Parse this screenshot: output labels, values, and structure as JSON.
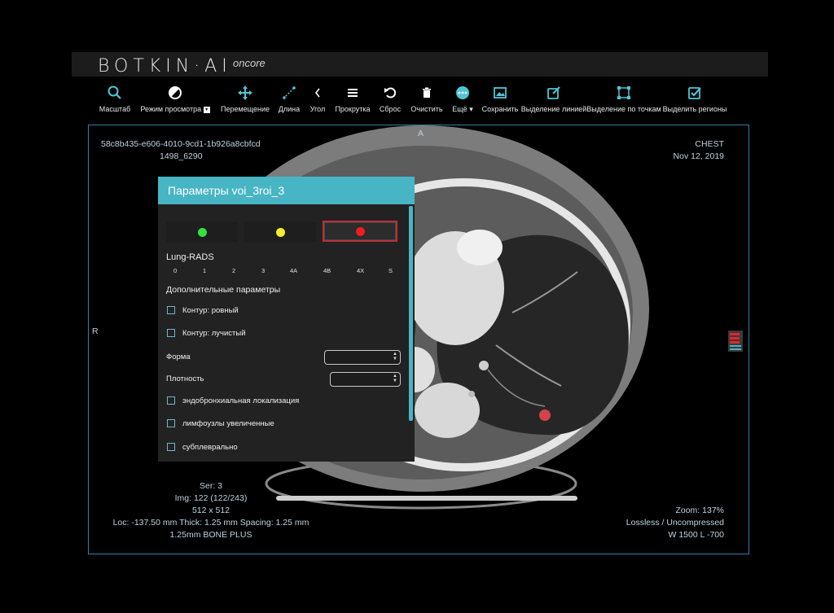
{
  "app": {
    "logo": "BOTKIN·AI",
    "logo_sub": "oncore"
  },
  "toolbar": [
    {
      "label": "Масштаб",
      "icon": "search-icon"
    },
    {
      "label": "Режим просмотра",
      "icon": "contrast-icon"
    },
    {
      "label": "Перемещение",
      "icon": "move-icon"
    },
    {
      "label": "Длина",
      "icon": "ruler-icon"
    },
    {
      "label": "Угол",
      "icon": "angle-icon"
    },
    {
      "label": "Прокрутка",
      "icon": "menu-icon"
    },
    {
      "label": "Сброс",
      "icon": "undo-icon"
    },
    {
      "label": "Очистить",
      "icon": "trash-icon"
    },
    {
      "label": "Ещё",
      "icon": "more-icon"
    },
    {
      "label": "Сохранить",
      "icon": "image-icon"
    },
    {
      "label": "Выделение линией",
      "icon": "edit-icon"
    },
    {
      "label": "Выделение по точкам",
      "icon": "points-select-icon"
    },
    {
      "label": "Выделить регионы",
      "icon": "check-square-icon"
    }
  ],
  "viewer": {
    "top_left": [
      "58c8b435-e606-4010-9cd1-1b926a8cbfcd",
      "1498_6290"
    ],
    "top_right": [
      "CHEST",
      "Nov 12, 2019"
    ],
    "orient_top": "A",
    "orient_left": "R",
    "bottom_left": [
      "Ser: 3",
      "Img: 122 (122/243)",
      "512 x 512",
      "Loc: -137.50 mm Thick: 1.25 mm Spacing: 1.25 mm",
      "1.25mm BONE PLUS"
    ],
    "bottom_right": [
      "Zoom: 137%",
      "Lossless / Uncompressed",
      "W 1500 L -700"
    ]
  },
  "panel": {
    "title": "Параметры voi_3roi_3",
    "colors": [
      {
        "name": "green",
        "hex": "#33e23e"
      },
      {
        "name": "yellow",
        "hex": "#f2ee2e"
      },
      {
        "name": "red",
        "hex": "#ee1d24",
        "selected": true
      }
    ],
    "lung_rads_label": "Lung-RADS",
    "lung_rads_options": [
      "0",
      "1",
      "2",
      "3",
      "4A",
      "4B",
      "4X",
      "S"
    ],
    "extra_label": "Дополнительные параметры",
    "check_contour_smooth": "Контур: ровный",
    "check_contour_spiculated": "Контур: лучистый",
    "shape_label": "Форма",
    "density_label": "Плотность",
    "check_endobronchial": "эндобронхиальная локализация",
    "check_lymph": "лимфоузлы увеличенные",
    "check_subpleural": "субплеврально"
  },
  "colors": {
    "accent": "#47b5c4",
    "toolbar_icon": "#4fc6d6",
    "viewport_border": "#2f7fa8"
  }
}
